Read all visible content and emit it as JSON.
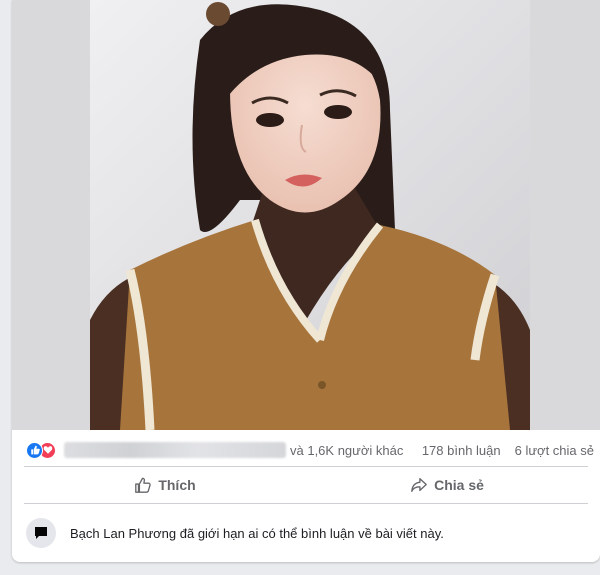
{
  "post": {
    "photo": {
      "alt_icon": "post-photo",
      "background_color": "#d9d9dc"
    },
    "reactions": {
      "icons": [
        "like-icon",
        "love-icon"
      ],
      "others_text": "và 1,6K người khác",
      "comments": "178 bình luận",
      "shares": "6 lượt chia sẻ"
    },
    "actions": {
      "like_label": "Thích",
      "share_label": "Chia sẻ"
    },
    "restriction": {
      "icon": "comment-bubble-icon",
      "text": "Bạch Lan Phương đã giới hạn ai có thể bình luận về bài viết này."
    }
  },
  "colors": {
    "like_blue": "#1877f2",
    "love_red": "#f33e58",
    "secondary_text": "#65676b",
    "divider": "#ced0d4"
  }
}
